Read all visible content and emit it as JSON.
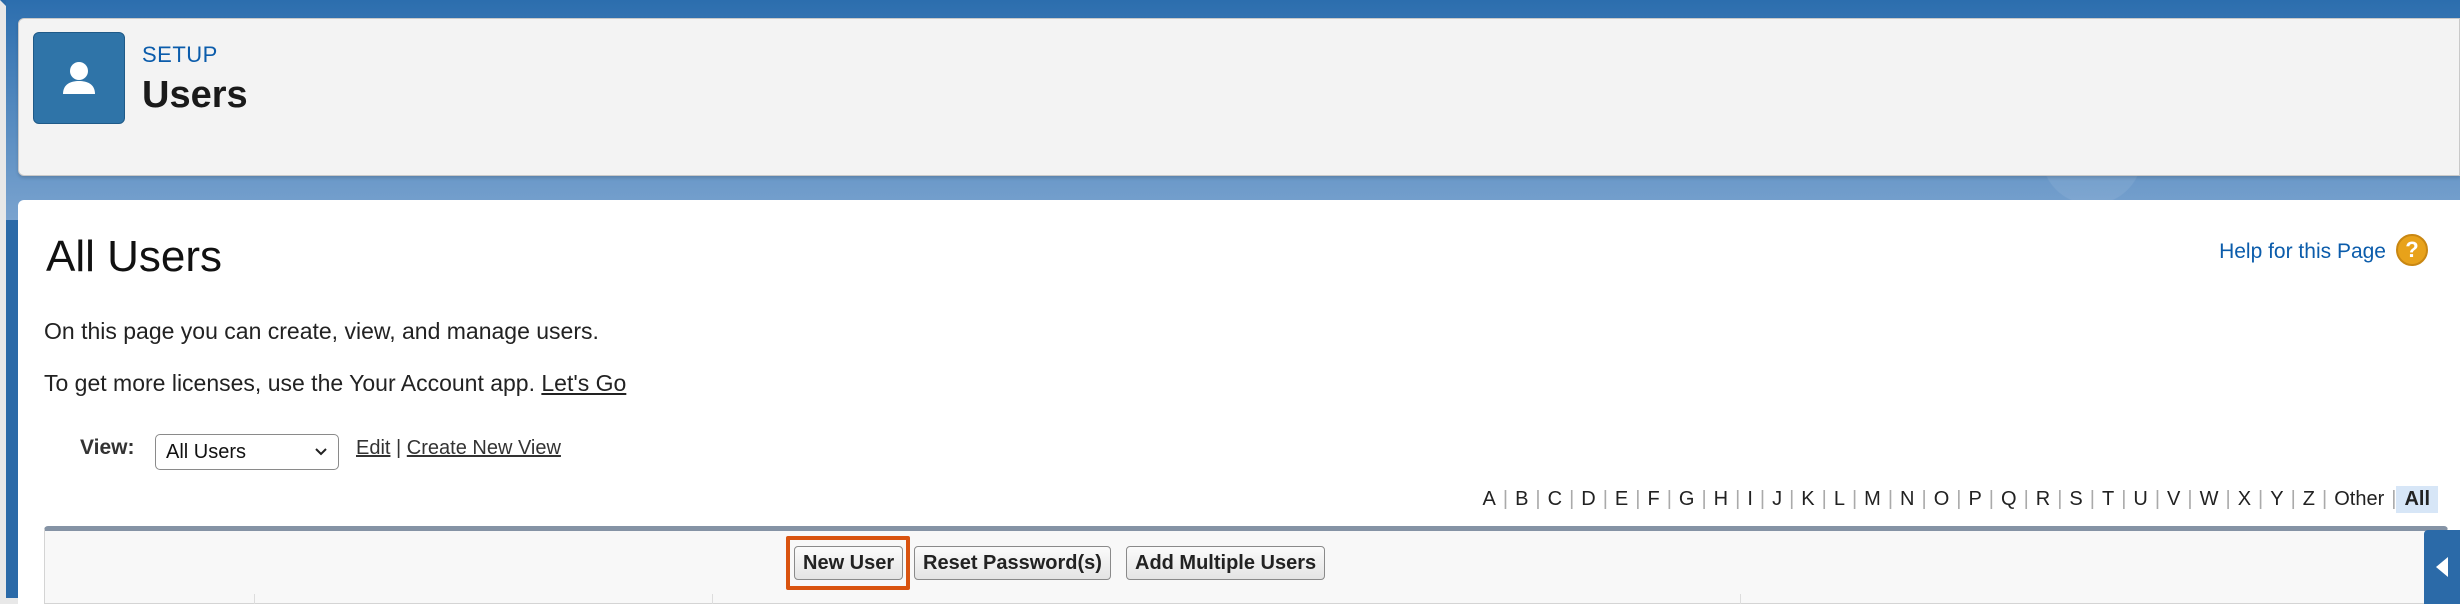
{
  "header": {
    "eyebrow": "SETUP",
    "title": "Users",
    "icon": "user-icon"
  },
  "page": {
    "title": "All Users",
    "help_link": "Help for this Page",
    "help_icon": "question-mark-icon",
    "description": "On this page you can create, view, and manage users.",
    "licenses_text": "To get more licenses, use the Your Account app. ",
    "licenses_link": "Let's Go"
  },
  "view": {
    "label": "View:",
    "selected": "All Users",
    "edit_link": "Edit",
    "separator": "|",
    "create_link": "Create New View"
  },
  "alphabet": [
    "A",
    "B",
    "C",
    "D",
    "E",
    "F",
    "G",
    "H",
    "I",
    "J",
    "K",
    "L",
    "M",
    "N",
    "O",
    "P",
    "Q",
    "R",
    "S",
    "T",
    "U",
    "V",
    "W",
    "X",
    "Y",
    "Z",
    "Other",
    "All"
  ],
  "alphabet_selected": "All",
  "toolbar": {
    "new_user": "New User",
    "reset_password": "Reset Password(s)",
    "add_multiple": "Add Multiple Users"
  },
  "colors": {
    "brand_blue": "#2b6aa8",
    "link_blue": "#0b5cab",
    "highlight": "#d9530f"
  }
}
